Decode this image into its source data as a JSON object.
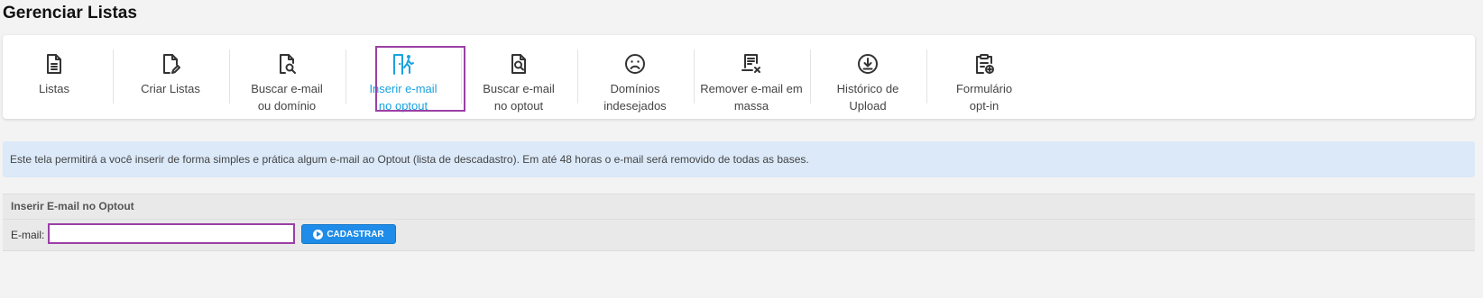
{
  "page": {
    "title": "Gerenciar Listas"
  },
  "nav": {
    "items": [
      {
        "label": "Listas",
        "icon": "file-list-icon",
        "active": false
      },
      {
        "label": "Criar Listas",
        "icon": "file-edit-icon",
        "active": false
      },
      {
        "label": "Buscar e-mail\nou domínio",
        "icon": "file-search-icon",
        "active": false
      },
      {
        "label": "Inserir e-mail\nno optout",
        "icon": "door-exit-icon",
        "active": true
      },
      {
        "label": "Buscar e-mail\nno optout",
        "icon": "file-search-icon",
        "active": false
      },
      {
        "label": "Domínios\nindesejados",
        "icon": "sad-face-icon",
        "active": false
      },
      {
        "label": "Remover e-mail em\nmassa",
        "icon": "document-remove-icon",
        "active": false
      },
      {
        "label": "Histórico de\nUpload",
        "icon": "download-circle-icon",
        "active": false
      },
      {
        "label": "Formulário\nopt-in",
        "icon": "clipboard-add-icon",
        "active": false
      }
    ]
  },
  "info": {
    "text": "Este tela permitirá a você inserir de forma simples e prática algum e-mail ao Optout (lista de descadastro). Em até 48 horas o e-mail será removido de todas as bases."
  },
  "form": {
    "title": "Inserir E-mail no Optout",
    "email_label": "E-mail:",
    "email_value": "",
    "email_placeholder": "",
    "submit_label": "CADASTRAR"
  },
  "colors": {
    "accent": "#18a2e0",
    "highlight": "#9b3fa5",
    "button": "#1e8ce8",
    "info_bg": "#dbe9f9"
  }
}
